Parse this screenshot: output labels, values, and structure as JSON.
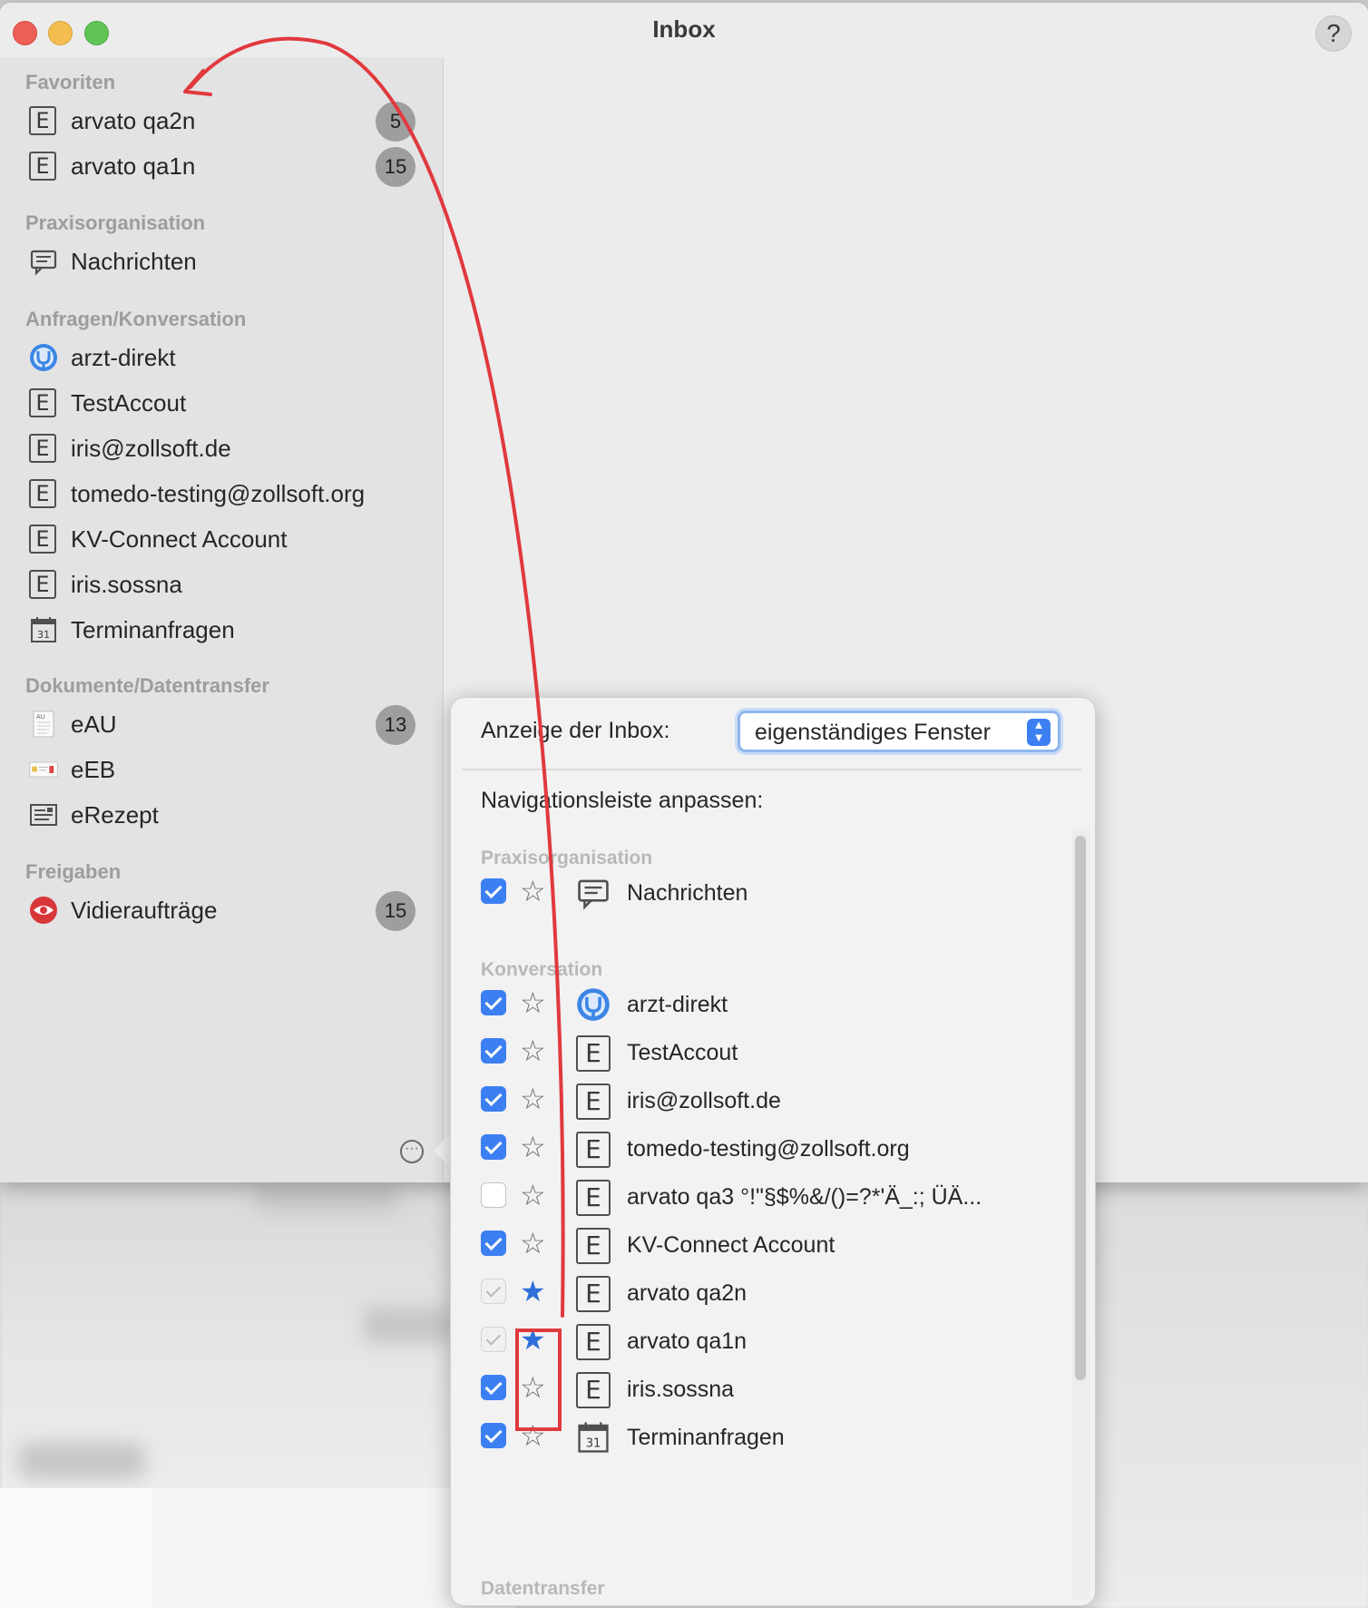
{
  "window": {
    "title": "Inbox",
    "help_label": "?"
  },
  "sidebar": {
    "sections": [
      {
        "title": "Favoriten",
        "items": [
          {
            "label": "arvato qa2n",
            "badge": "5",
            "icon": "e-box-icon"
          },
          {
            "label": "arvato qa1n",
            "badge": "15",
            "icon": "e-box-icon"
          }
        ]
      },
      {
        "title": "Praxisorganisation",
        "items": [
          {
            "label": "Nachrichten",
            "icon": "message-icon"
          }
        ]
      },
      {
        "title": "Anfragen/Konversation",
        "items": [
          {
            "label": "arzt-direkt",
            "icon": "stethoscope-icon"
          },
          {
            "label": "TestAccout",
            "icon": "e-box-icon"
          },
          {
            "label": "iris@zollsoft.de",
            "icon": "e-box-icon"
          },
          {
            "label": "tomedo-testing@zollsoft.org",
            "icon": "e-box-icon"
          },
          {
            "label": "KV-Connect Account",
            "icon": "e-box-icon"
          },
          {
            "label": "iris.sossna",
            "icon": "e-box-icon"
          },
          {
            "label": "Terminanfragen",
            "icon": "calendar-icon"
          }
        ]
      },
      {
        "title": "Dokumente/Datentransfer",
        "items": [
          {
            "label": "eAU",
            "badge": "13",
            "icon": "document-icon"
          },
          {
            "label": "eEB",
            "icon": "card-icon"
          },
          {
            "label": "eRezept",
            "icon": "prescription-icon"
          }
        ]
      },
      {
        "title": "Freigaben",
        "items": [
          {
            "label": "Vidieraufträge",
            "badge": "15",
            "icon": "eye-icon"
          }
        ]
      }
    ],
    "more_label": "···"
  },
  "popover": {
    "display_label": "Anzeige der Inbox:",
    "display_value": "eigenständiges Fenster",
    "nav_label": "Navigationsleiste anpassen:",
    "sections": [
      {
        "title": "Praxisorganisation",
        "rows": [
          {
            "label": "Nachrichten",
            "checked": "on",
            "favorite": false,
            "icon": "message-icon"
          }
        ]
      },
      {
        "title": "Konversation",
        "rows": [
          {
            "label": "arzt-direkt",
            "checked": "on",
            "favorite": false,
            "icon": "stethoscope-icon"
          },
          {
            "label": "TestAccout",
            "checked": "on",
            "favorite": false,
            "icon": "e-box-icon"
          },
          {
            "label": "iris@zollsoft.de",
            "checked": "on",
            "favorite": false,
            "icon": "e-box-icon"
          },
          {
            "label": "tomedo-testing@zollsoft.org",
            "checked": "on",
            "favorite": false,
            "icon": "e-box-icon"
          },
          {
            "label": "arvato qa3 °!\"§$%&/()=?*'Ä_:; ÜÄ...",
            "checked": "off",
            "favorite": false,
            "icon": "e-box-icon"
          },
          {
            "label": "KV-Connect Account",
            "checked": "on",
            "favorite": false,
            "icon": "e-box-icon"
          },
          {
            "label": "arvato qa2n",
            "checked": "dis",
            "favorite": true,
            "icon": "e-box-icon"
          },
          {
            "label": "arvato qa1n",
            "checked": "dis",
            "favorite": true,
            "icon": "e-box-icon"
          },
          {
            "label": "iris.sossna",
            "checked": "on",
            "favorite": false,
            "icon": "e-box-icon"
          },
          {
            "label": "Terminanfragen",
            "checked": "on",
            "favorite": false,
            "icon": "calendar-icon"
          }
        ]
      },
      {
        "title": "Datentransfer",
        "rows": []
      }
    ]
  },
  "colors": {
    "accent": "#3c7ff2",
    "annotation": "#e0393e",
    "favorite_star": "#2f6fd9"
  }
}
